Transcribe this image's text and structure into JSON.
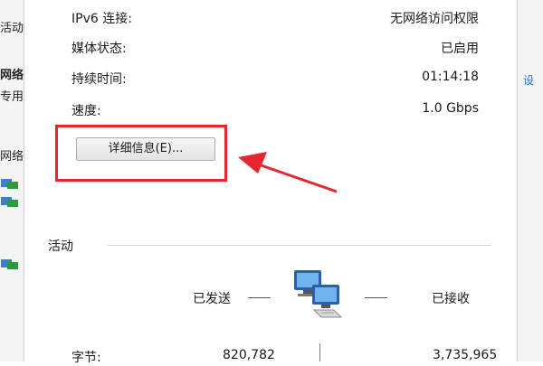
{
  "connection": {
    "rows": [
      {
        "label": "IPv6 连接:",
        "value": "无网络访问权限"
      },
      {
        "label": "媒体状态:",
        "value": "已启用"
      },
      {
        "label": "持续时间:",
        "value": "01:14:18"
      },
      {
        "label": "速度:",
        "value": "1.0 Gbps"
      }
    ],
    "details_button": "详细信息(E)..."
  },
  "activity": {
    "title": "活动",
    "sent_label": "已发送",
    "received_label": "已接收",
    "bytes_label": "字节:",
    "bytes_sent": "820,782",
    "bytes_received": "3,735,965"
  },
  "background": {
    "left_fragments": [
      "活动",
      "网络",
      "专用",
      "网络"
    ],
    "right_fragment": "设"
  },
  "colors": {
    "highlight": "#e4262e",
    "link": "#1e6fd1"
  },
  "icons": {
    "activity": "network-computers-icon",
    "annotation": "red-arrow"
  }
}
